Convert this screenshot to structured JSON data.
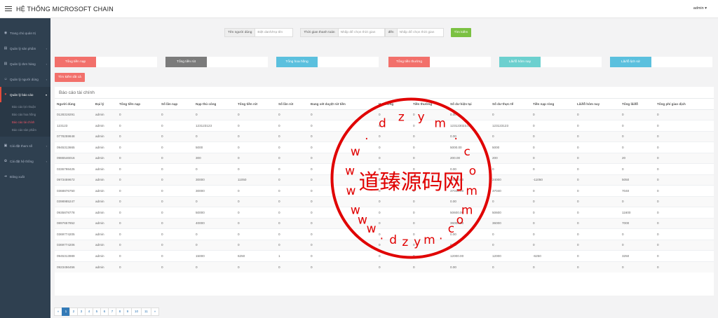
{
  "header": {
    "title": "HỆ THỐNG MICROSOFT CHAIN",
    "user": "admin ▾"
  },
  "sidebar": {
    "items": [
      {
        "label": "Trang chủ quản trị",
        "icon": "dashboard-icon",
        "glyph": "◉"
      },
      {
        "label": "Quản lý sản phẩm",
        "icon": "product-icon",
        "glyph": "▤",
        "caret": "‹"
      },
      {
        "label": "Quản lý đơn hàng",
        "icon": "order-icon",
        "glyph": "▤",
        "caret": "‹"
      },
      {
        "label": "Quản lý người dùng",
        "icon": "user-icon",
        "glyph": "☺",
        "caret": "‹"
      },
      {
        "label": "Quản lý báo cáo",
        "icon": "report-icon",
        "glyph": "♥",
        "caret": "▾"
      }
    ],
    "subitems": [
      {
        "label": "Báo cáo lợi nhuận"
      },
      {
        "label": "Báo cáo hoa hồng"
      },
      {
        "label": "Báo cáo tài chính"
      },
      {
        "label": "Báo cáo sản phẩm"
      }
    ],
    "items_after": [
      {
        "label": "Cài đặt tham số",
        "icon": "settings-icon",
        "glyph": "▣",
        "caret": "‹"
      },
      {
        "label": "Cài đặt hệ thống",
        "icon": "gear-icon",
        "glyph": "✿",
        "caret": "‹"
      },
      {
        "label": "Đăng xuất",
        "icon": "logout-icon",
        "glyph": "➔"
      }
    ]
  },
  "filters": {
    "user_label": "Tên người dùng",
    "user_placeholder": "Biệt danh/Hạ tên",
    "time_label": "Thời gian thanh toán",
    "from_placeholder": "Nhấp để chọn thời gian",
    "to_label": "đến",
    "to_placeholder": "Nhấp để chọn thời gian",
    "search_button": "Tìm kiếm"
  },
  "stats": [
    {
      "label": "Tổng tiền nạp",
      "color": "#f2706b"
    },
    {
      "label": "Tổng tiền rút",
      "color": "#7b7b7b"
    },
    {
      "label": "Tổng hoa hồng",
      "color": "#5bc0de"
    },
    {
      "label": "Tổng tiền thưởng",
      "color": "#f2706b"
    },
    {
      "label": "Lãi/lỗ hôm nay",
      "color": "#6cd0cf"
    },
    {
      "label": "Lãi/lỗ lịch sử",
      "color": "#5bc0de"
    }
  ],
  "search_all_button": "Tìm kiếm tất cả",
  "report": {
    "title": "Báo cáo tài chính",
    "columns": [
      "Người dùng",
      "Đại lý",
      "Tổng tiền nạp",
      "Số lần nạp",
      "Nạp thủ công",
      "Tổng tiền rút",
      "Số lần rút",
      "Đang xét duyệt rút tiền",
      "Hoa hồng",
      "Tiền thưởng",
      "Số dư hiện tại",
      "Số dư thực tế",
      "Tiền nạp ròng",
      "Lãi/lỗ hôm nay",
      "Tổng lãi/lỗ",
      "Tổng phí giao dịch"
    ],
    "rows": [
      [
        "0128319291",
        "admin",
        "0",
        "0",
        "0",
        "0",
        "0",
        "0",
        "0",
        "0",
        "0.00",
        "0",
        "0",
        "0",
        "0",
        "0"
      ],
      [
        "123123",
        "admin",
        "0",
        "0",
        "123123123",
        "0",
        "0",
        "0",
        "0",
        "0",
        "123123023.00",
        "123123123",
        "0",
        "0",
        "0",
        "0"
      ],
      [
        "0778259848",
        "admin",
        "0",
        "0",
        "0",
        "0",
        "0",
        "0",
        "0",
        "0",
        "0.00",
        "0",
        "0",
        "0",
        "0",
        "0"
      ],
      [
        "0945313665",
        "admin",
        "0",
        "0",
        "5000",
        "0",
        "0",
        "0",
        "0",
        "0",
        "5000.00",
        "5000",
        "0",
        "0",
        "0",
        "0"
      ],
      [
        "0986546016",
        "admin",
        "0",
        "0",
        "300",
        "0",
        "0",
        "0",
        "0",
        "0",
        "200.00",
        "200",
        "0",
        "0",
        "20",
        "0"
      ],
      [
        "0336798425",
        "admin",
        "0",
        "0",
        "0",
        "0",
        "0",
        "0",
        "0",
        "0",
        "0.00",
        "0",
        "0",
        "0",
        "0",
        "0"
      ],
      [
        "0973459672",
        "admin",
        "0",
        "0",
        "30000",
        "11050",
        "0",
        "0",
        "0",
        "0",
        "24000.00",
        "24000",
        "-11050",
        "0",
        "5050",
        "0"
      ],
      [
        "0368876750",
        "admin",
        "0",
        "0",
        "30000",
        "0",
        "0",
        "0",
        "0",
        "0",
        "37040.00",
        "37040",
        "0",
        "0",
        "7040",
        "0"
      ],
      [
        "0398985247",
        "admin",
        "0",
        "0",
        "0",
        "0",
        "0",
        "0",
        "0",
        "0",
        "0.00",
        "0",
        "0",
        "0",
        "0",
        "0"
      ],
      [
        "0935878778",
        "admin",
        "0",
        "0",
        "50000",
        "0",
        "0",
        "0",
        "0",
        "0",
        "50600.00",
        "50600",
        "0",
        "0",
        "11600",
        "0"
      ],
      [
        "0897657852",
        "admin",
        "0",
        "0",
        "40000",
        "0",
        "0",
        "0",
        "0",
        "0",
        "36000.00",
        "36000",
        "0",
        "0",
        "7000",
        "0"
      ],
      [
        "0369774205",
        "admin",
        "0",
        "0",
        "0",
        "0",
        "0",
        "0",
        "0",
        "0",
        "0.00",
        "0",
        "0",
        "0",
        "0",
        "0"
      ],
      [
        "0369774206",
        "admin",
        "0",
        "0",
        "0",
        "0",
        "0",
        "0",
        "0",
        "0",
        "0.00",
        "0",
        "0",
        "0",
        "0",
        "0"
      ],
      [
        "0945313989",
        "admin",
        "0",
        "0",
        "15000",
        "6250",
        "1",
        "0",
        "0",
        "0",
        "12000.00",
        "12000",
        "-6250",
        "0",
        "3250",
        "0"
      ],
      [
        "0923456456",
        "admin",
        "0",
        "0",
        "0",
        "0",
        "0",
        "0",
        "0",
        "0",
        "0.00",
        "0",
        "0",
        "0",
        "0",
        "0"
      ]
    ]
  },
  "pagination": {
    "prev": "«",
    "pages": [
      "1",
      "2",
      "3",
      "4",
      "5",
      "6",
      "7",
      "8",
      "9",
      "10",
      "11"
    ],
    "next": "»",
    "current": "1"
  },
  "watermark": {
    "text": "道臻源码网",
    "domain": "www.dzym.com",
    "color": "#e00000"
  }
}
